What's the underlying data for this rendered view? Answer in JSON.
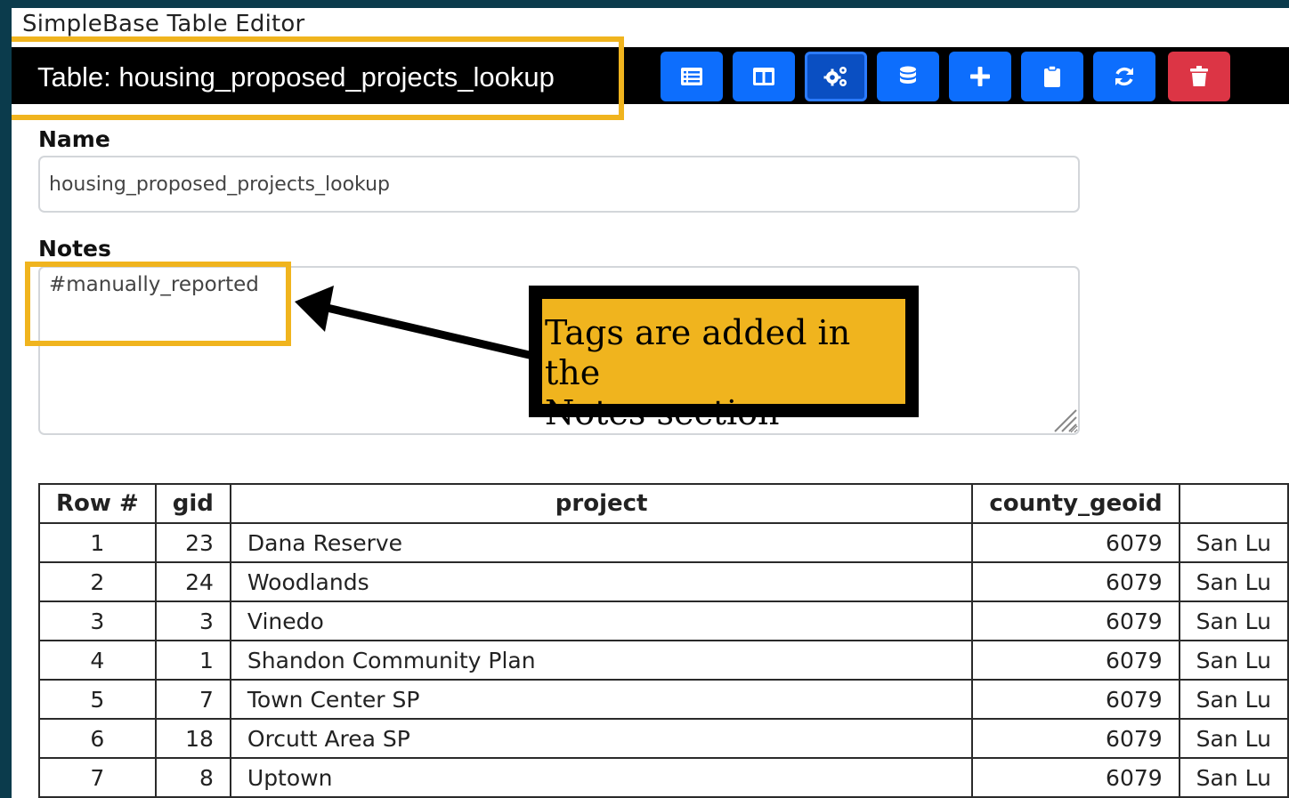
{
  "app": {
    "title": "SimpleBase Table Editor"
  },
  "toolbar": {
    "table_label": "Table: housing_proposed_projects_lookup",
    "buttons": [
      {
        "icon": "list-icon"
      },
      {
        "icon": "columns-icon"
      },
      {
        "icon": "gears-icon",
        "active": true
      },
      {
        "icon": "database-icon"
      },
      {
        "icon": "plus-icon"
      },
      {
        "icon": "clipboard-icon"
      },
      {
        "icon": "refresh-icon"
      },
      {
        "icon": "trash-icon",
        "color": "#dc3545"
      }
    ]
  },
  "form": {
    "name_label": "Name",
    "name_value": "housing_proposed_projects_lookup",
    "notes_label": "Notes",
    "notes_value": "#manually_reported"
  },
  "annotation": {
    "callout_line1": "Tags are added in the",
    "callout_line2": "Notes section",
    "highlight_color": "#f0b41e"
  },
  "table": {
    "columns": [
      "Row #",
      "gid",
      "project",
      "county_geoid",
      ""
    ],
    "rows": [
      {
        "row": "1",
        "gid": "23",
        "project": "Dana Reserve",
        "county_geoid": "6079",
        "extra": "San Lu"
      },
      {
        "row": "2",
        "gid": "24",
        "project": "Woodlands",
        "county_geoid": "6079",
        "extra": "San Lu"
      },
      {
        "row": "3",
        "gid": "3",
        "project": "Vinedo",
        "county_geoid": "6079",
        "extra": "San Lu"
      },
      {
        "row": "4",
        "gid": "1",
        "project": "Shandon Community Plan",
        "county_geoid": "6079",
        "extra": "San Lu"
      },
      {
        "row": "5",
        "gid": "7",
        "project": "Town Center SP",
        "county_geoid": "6079",
        "extra": "San Lu"
      },
      {
        "row": "6",
        "gid": "18",
        "project": "Orcutt Area SP",
        "county_geoid": "6079",
        "extra": "San Lu"
      },
      {
        "row": "7",
        "gid": "8",
        "project": "Uptown",
        "county_geoid": "6079",
        "extra": "San Lu"
      }
    ]
  }
}
